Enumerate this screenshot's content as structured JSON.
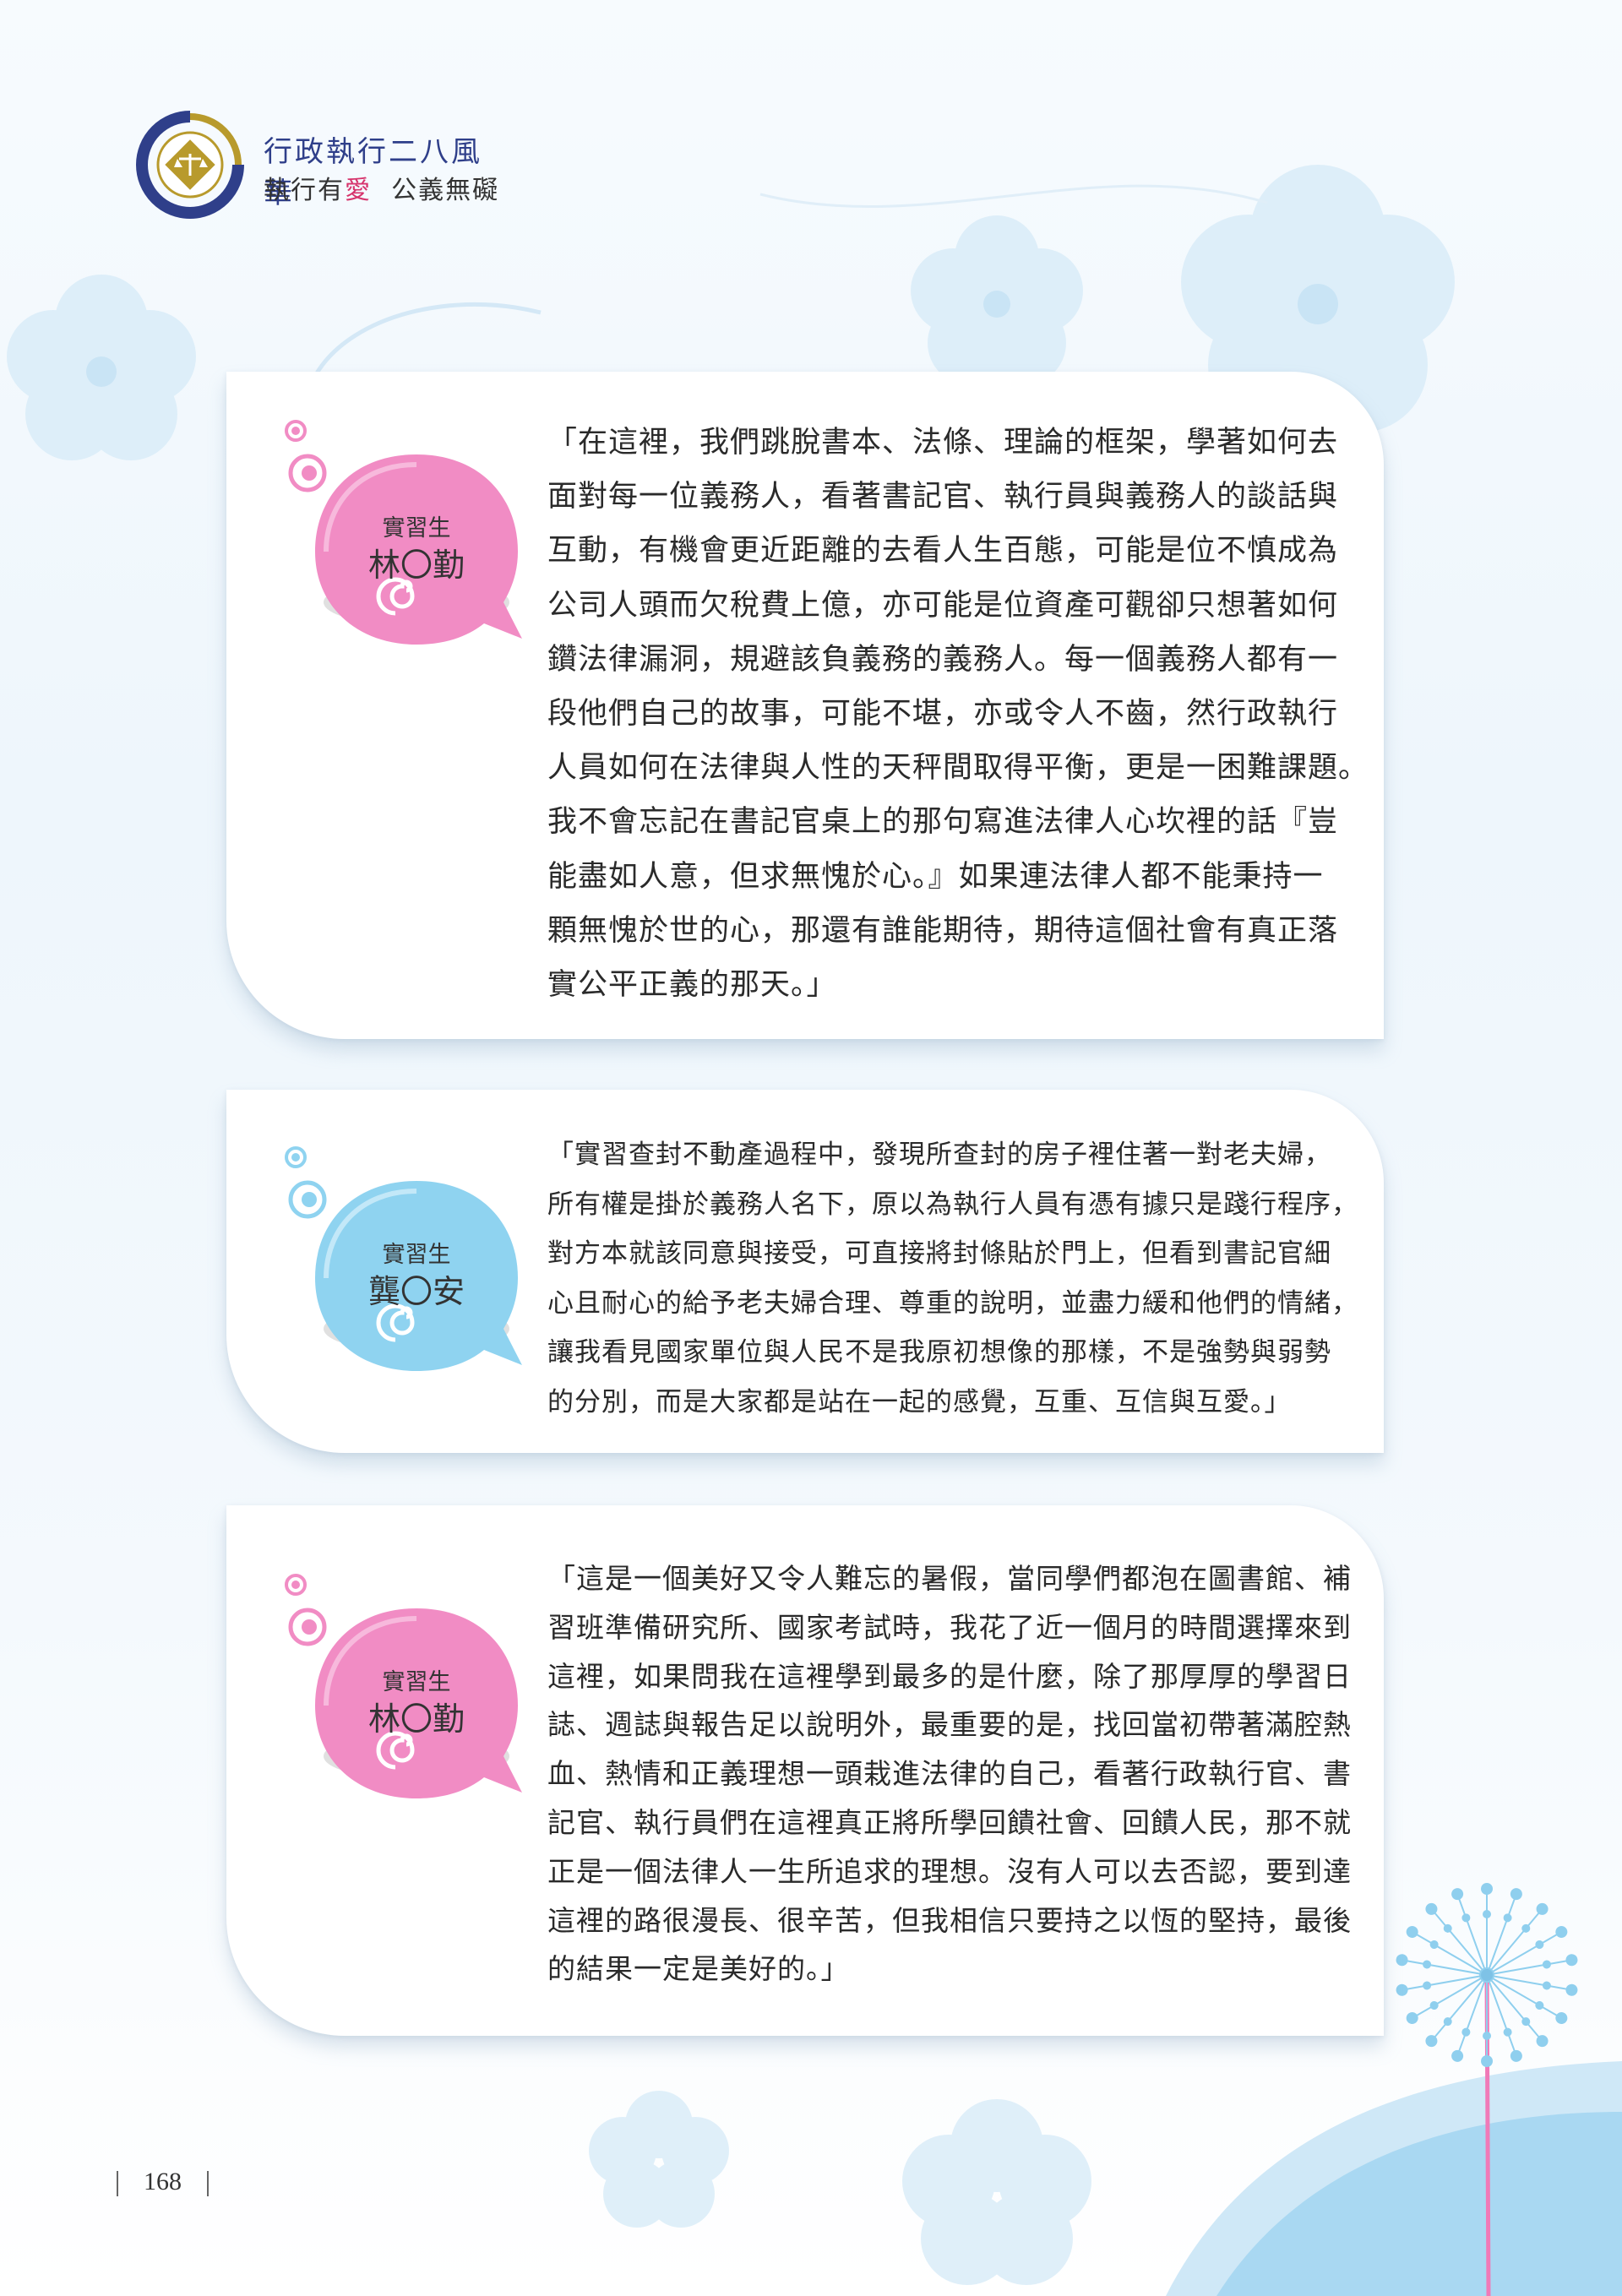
{
  "header": {
    "logo_line1": "行政執行二八風華",
    "logo_line2_pre": "執行有",
    "logo_line2_accent": "愛",
    "logo_line2_post": "  公義無礙"
  },
  "colors": {
    "pink": "#f18cc4",
    "blue": "#8fd3f0",
    "navy": "#2f3f8a",
    "accent_red": "#d6336c",
    "gold": "#b89a2c"
  },
  "testimonials": [
    {
      "role": "實習生",
      "name": "林〇勤",
      "bubble_color": "pink",
      "lines": [
        "「在這裡，我們跳脫書本、法條、理論的框架，學著如何去",
        "面對每一位義務人，看著書記官、執行員與義務人的談話與",
        "互動，有機會更近距離的去看人生百態，可能是位不慎成為",
        "公司人頭而欠稅費上億，亦可能是位資產可觀卻只想著如何",
        "鑽法律漏洞，規避該負義務的義務人。每一個義務人都有一",
        "段他們自己的故事，可能不堪，亦或令人不齒，然行政執行",
        "人員如何在法律與人性的天秤間取得平衡，更是一困難課題。",
        "我不會忘記在書記官桌上的那句寫進法律人心坎裡的話『豈",
        "能盡如人意，但求無愧於心。』如果連法律人都不能秉持一",
        "顆無愧於世的心，那還有誰能期待，期待這個社會有真正落",
        "實公平正義的那天。」"
      ]
    },
    {
      "role": "實習生",
      "name": "龔〇安",
      "bubble_color": "blue",
      "lines": [
        "「實習查封不動產過程中，發現所查封的房子裡住著一對老夫婦，",
        "所有權是掛於義務人名下，原以為執行人員有憑有據只是踐行程序，",
        "對方本就該同意與接受，可直接將封條貼於門上，但看到書記官細",
        "心且耐心的給予老夫婦合理、尊重的說明，並盡力緩和他們的情緒，",
        "讓我看見國家單位與人民不是我原初想像的那樣，不是強勢與弱勢",
        "的分別，而是大家都是站在一起的感覺，互重、互信與互愛。」"
      ]
    },
    {
      "role": "實習生",
      "name": "林〇勤",
      "bubble_color": "pink",
      "lines": [
        "「這是一個美好又令人難忘的暑假，當同學們都泡在圖書館、補",
        "習班準備研究所、國家考試時，我花了近一個月的時間選擇來到",
        "這裡，如果問我在這裡學到最多的是什麼，除了那厚厚的學習日",
        "誌、週誌與報告足以說明外，最重要的是，找回當初帶著滿腔熱",
        "血、熱情和正義理想一頭栽進法律的自己，看著行政執行官、書",
        "記官、執行員們在這裡真正將所學回饋社會、回饋人民，那不就",
        "正是一個法律人一生所追求的理想。沒有人可以去否認，要到達",
        "這裡的路很漫長、很辛苦，但我相信只要持之以恆的堅持，最後",
        "的結果一定是美好的。」"
      ]
    }
  ],
  "footer": {
    "page_number": "168"
  }
}
